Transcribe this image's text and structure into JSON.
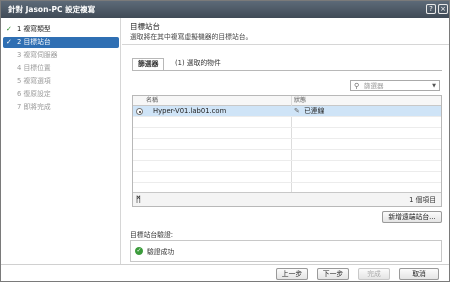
{
  "window": {
    "title": "針對 Jason-PC 設定複寫"
  },
  "titlebar_icons": {
    "help": "help-icon",
    "close": "close-icon"
  },
  "steps": [
    {
      "num": "1",
      "label": "複寫類型",
      "done": true,
      "active": false
    },
    {
      "num": "2",
      "label": "目標站台",
      "done": true,
      "active": true
    },
    {
      "num": "3",
      "label": "複寫伺服器",
      "done": false,
      "active": false
    },
    {
      "num": "4",
      "label": "目標位置",
      "done": false,
      "active": false
    },
    {
      "num": "5",
      "label": "複寫選項",
      "done": false,
      "active": false
    },
    {
      "num": "6",
      "label": "復原設定",
      "done": false,
      "active": false
    },
    {
      "num": "7",
      "label": "即將完成",
      "done": false,
      "active": false
    }
  ],
  "header": {
    "title": "目標站台",
    "description": "選取將在其中複寫虛擬機器的目標站台。"
  },
  "tabs": [
    {
      "label": "篩選器",
      "active": true
    },
    {
      "label": "(1) 選取的物件",
      "active": false
    }
  ],
  "filter": {
    "placeholder": "篩選器"
  },
  "table": {
    "columns": [
      "名稱",
      "狀態"
    ],
    "rows": [
      {
        "name": "Hyper-V01.lab01.com",
        "status": "已連線",
        "selected": true
      }
    ],
    "empty_rows": 7,
    "count_text": "1 個項目"
  },
  "buttons": {
    "new_site": "新增遠端站台...",
    "back": "上一步",
    "next": "下一步",
    "finish": "完成",
    "cancel": "取消"
  },
  "validation": {
    "label": "目標站台驗證:",
    "message": "驗證成功"
  },
  "colors": {
    "accent": "#2f6fb3",
    "selected_row": "#cfe4f7",
    "success": "#3b9b3b",
    "titlebar": "#4a5663"
  }
}
